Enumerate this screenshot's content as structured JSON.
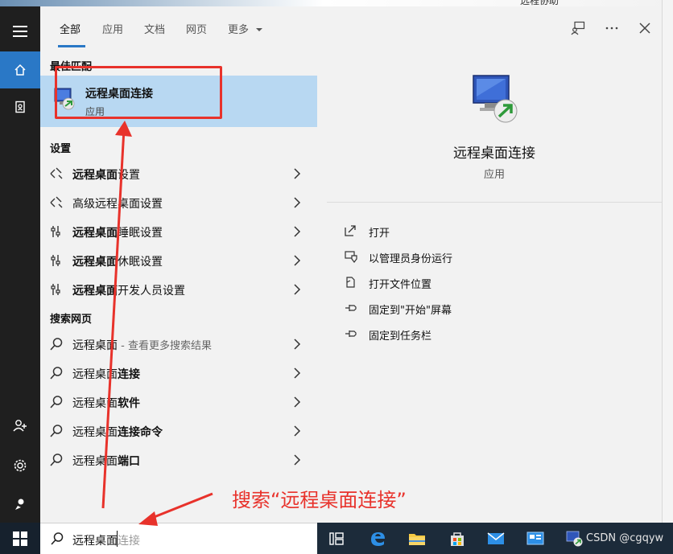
{
  "background": {
    "right_window_text": "远程协助"
  },
  "tabs": [
    {
      "label": "全部",
      "active": true
    },
    {
      "label": "应用"
    },
    {
      "label": "文档"
    },
    {
      "label": "网页"
    },
    {
      "label": "更多"
    }
  ],
  "sections": {
    "best_match": "最佳匹配",
    "settings": "设置",
    "web": "搜索网页"
  },
  "best_match": {
    "name": "远程桌面连接",
    "type": "应用"
  },
  "settings_items": [
    {
      "bold": "远程桌面",
      "rest": "设置",
      "icon": "remote-settings-icon"
    },
    {
      "bold": "",
      "rest": "高级远程桌面设置",
      "icon": "remote-settings-icon"
    },
    {
      "bold": "远程桌面",
      "rest": "睡眠设置",
      "icon": "sliders-icon"
    },
    {
      "bold": "远程桌面",
      "rest": "休眠设置",
      "icon": "sliders-icon"
    },
    {
      "bold": "远程桌面",
      "rest": "开发人员设置",
      "icon": "sliders-icon"
    }
  ],
  "web_items": [
    {
      "plain": "远程桌面",
      "bold": "",
      "dim": " - 查看更多搜索结果"
    },
    {
      "plain": "远程桌面",
      "bold": "连接",
      "dim": ""
    },
    {
      "plain": "远程桌面",
      "bold": "软件",
      "dim": ""
    },
    {
      "plain": "远程桌面",
      "bold": "连接命令",
      "dim": ""
    },
    {
      "plain": "远程桌面",
      "bold": "端口",
      "dim": ""
    }
  ],
  "detail": {
    "title": "远程桌面连接",
    "subtitle": "应用",
    "actions": [
      {
        "label": "打开",
        "icon": "open-icon"
      },
      {
        "label": "以管理员身份运行",
        "icon": "shield-icon"
      },
      {
        "label": "打开文件位置",
        "icon": "file-location-icon"
      },
      {
        "label": "固定到\"开始\"屏幕",
        "icon": "pin-icon"
      },
      {
        "label": "固定到任务栏",
        "icon": "pin-icon"
      }
    ]
  },
  "search": {
    "typed": "远程桌面",
    "hint": "连接"
  },
  "annotation": {
    "text": "搜索“远程桌面连接”"
  },
  "watermark": "CSDN @cgqyw",
  "colors": {
    "accent": "#2a78c6",
    "highlight": "#b8d8f2",
    "annotation": "#e8322b",
    "rail": "#1f1f1f",
    "taskbar": "#1c2b3a"
  }
}
